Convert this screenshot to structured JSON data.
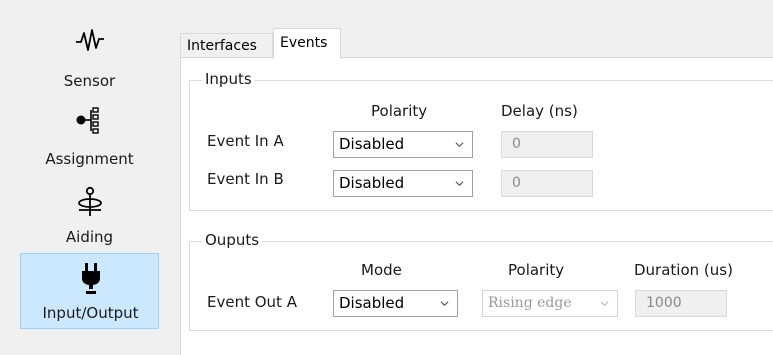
{
  "sidebar": {
    "items": [
      {
        "label": "Sensor",
        "icon": "waveform-icon"
      },
      {
        "label": "Assignment",
        "icon": "assignment-tree-icon"
      },
      {
        "label": "Aiding",
        "icon": "satellite-icon"
      },
      {
        "label": "Input/Output",
        "icon": "plug-icon",
        "selected": true
      }
    ]
  },
  "tabs": [
    {
      "label": "Interfaces",
      "active": false
    },
    {
      "label": "Events",
      "active": true
    }
  ],
  "inputs": {
    "title": "Inputs",
    "headers": {
      "polarity": "Polarity",
      "delay": "Delay (ns)"
    },
    "rows": [
      {
        "label": "Event In A",
        "polarity": "Disabled",
        "delay": "0"
      },
      {
        "label": "Event In B",
        "polarity": "Disabled",
        "delay": "0"
      }
    ]
  },
  "outputs": {
    "title": "Ouputs",
    "headers": {
      "mode": "Mode",
      "polarity": "Polarity",
      "duration": "Duration (us)"
    },
    "rows": [
      {
        "label": "Event Out A",
        "mode": "Disabled",
        "polarity": "Rising edge",
        "duration": "1000"
      }
    ]
  },
  "colors": {
    "selected_bg": "#cce8ff",
    "selected_border": "#99d1ff",
    "panel_bg": "#f0f0f0"
  }
}
